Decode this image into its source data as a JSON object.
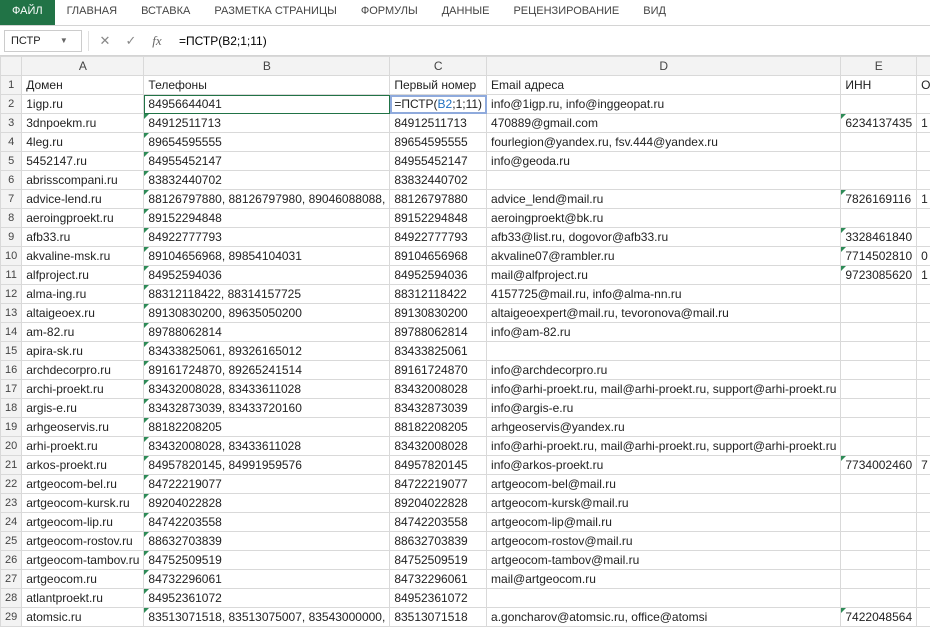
{
  "ribbon": {
    "file": "ФАЙЛ",
    "tabs": [
      "ГЛАВНАЯ",
      "ВСТАВКА",
      "РАЗМЕТКА СТРАНИЦЫ",
      "ФОРМУЛЫ",
      "ДАННЫЕ",
      "РЕЦЕНЗИРОВАНИЕ",
      "ВИД"
    ]
  },
  "formula_bar": {
    "namebox": "ПСТР",
    "formula": "=ПСТР(B2;1;11)"
  },
  "columns": [
    "A",
    "B",
    "C",
    "D",
    "E"
  ],
  "headers": {
    "A": "Домен",
    "B": "Телефоны",
    "C": "Первый номер",
    "D": "Email адреса",
    "E": "ИНН",
    "F": "О"
  },
  "active_cell_value": "84956644041",
  "edit_cell": {
    "prefix": "=ПСТР(",
    "ref": "B2",
    "suffix": ";1;11)"
  },
  "rows": [
    {
      "n": 2,
      "A": "1igp.ru",
      "B": "",
      "C": "",
      "D": "info@1igp.ru, info@inggeopat.ru",
      "E": ""
    },
    {
      "n": 3,
      "A": "3dnpoekm.ru",
      "B": "84912511713",
      "C": "84912511713",
      "D": "470889@gmail.com",
      "E": "6234137435",
      "Etri": true,
      "F": "1"
    },
    {
      "n": 4,
      "A": "4leg.ru",
      "B": "89654595555",
      "C": "89654595555",
      "D": "fourlegion@yandex.ru, fsv.444@yandex.ru",
      "E": ""
    },
    {
      "n": 5,
      "A": "5452147.ru",
      "B": "84955452147",
      "C": "84955452147",
      "D": "info@geoda.ru",
      "E": ""
    },
    {
      "n": 6,
      "A": "abrisscompani.ru",
      "B": "83832440702",
      "C": "83832440702",
      "D": "",
      "E": ""
    },
    {
      "n": 7,
      "A": "advice-lend.ru",
      "B": "88126797880, 88126797980, 89046088088,",
      "C": "88126797880",
      "D": "advice_lend@mail.ru",
      "E": "7826169116",
      "Etri": true,
      "F": "1"
    },
    {
      "n": 8,
      "A": "aeroingproekt.ru",
      "B": "89152294848",
      "C": "89152294848",
      "D": "aeroingproekt@bk.ru",
      "E": ""
    },
    {
      "n": 9,
      "A": "afb33.ru",
      "B": "84922777793",
      "C": "84922777793",
      "D": "afb33@list.ru, dogovor@afb33.ru",
      "E": "3328461840",
      "Etri": true
    },
    {
      "n": 10,
      "A": "akvaline-msk.ru",
      "B": "89104656968, 89854104031",
      "C": "89104656968",
      "D": "akvaline07@rambler.ru",
      "E": "7714502810",
      "Etri": true,
      "F": "0"
    },
    {
      "n": 11,
      "A": "alfproject.ru",
      "B": "84952594036",
      "C": "84952594036",
      "D": "mail@alfproject.ru",
      "E": "9723085620",
      "Etri": true,
      "F": "1"
    },
    {
      "n": 12,
      "A": "alma-ing.ru",
      "B": "88312118422, 88314157725",
      "C": "88312118422",
      "D": "4157725@mail.ru, info@alma-nn.ru",
      "E": ""
    },
    {
      "n": 13,
      "A": "altaigeoex.ru",
      "B": "89130830200, 89635050200",
      "C": "89130830200",
      "D": "altaigeoexpert@mail.ru, tevoronova@mail.ru",
      "E": ""
    },
    {
      "n": 14,
      "A": "am-82.ru",
      "B": "89788062814",
      "C": "89788062814",
      "D": "info@am-82.ru",
      "E": ""
    },
    {
      "n": 15,
      "A": "apira-sk.ru",
      "B": "83433825061, 89326165012",
      "C": "83433825061",
      "D": "",
      "E": ""
    },
    {
      "n": 16,
      "A": "archdecorpro.ru",
      "B": "89161724870, 89265241514",
      "C": "89161724870",
      "D": "info@archdecorpro.ru",
      "E": ""
    },
    {
      "n": 17,
      "A": "archi-proekt.ru",
      "B": "83432008028, 83433611028",
      "C": "83432008028",
      "D": "info@arhi-proekt.ru, mail@arhi-proekt.ru, support@arhi-proekt.ru",
      "E": ""
    },
    {
      "n": 18,
      "A": "argis-e.ru",
      "B": "83432873039, 83433720160",
      "C": "83432873039",
      "D": "info@argis-e.ru",
      "E": ""
    },
    {
      "n": 19,
      "A": "arhgeoservis.ru",
      "B": "88182208205",
      "C": "88182208205",
      "D": "arhgeoservis@yandex.ru",
      "E": ""
    },
    {
      "n": 20,
      "A": "arhi-proekt.ru",
      "B": "83432008028, 83433611028",
      "C": "83432008028",
      "D": "info@arhi-proekt.ru, mail@arhi-proekt.ru, support@arhi-proekt.ru",
      "E": ""
    },
    {
      "n": 21,
      "A": "arkos-proekt.ru",
      "B": "84957820145, 84991959576",
      "C": "84957820145",
      "D": "info@arkos-proekt.ru",
      "E": "7734002460",
      "Etri": true,
      "F": "7"
    },
    {
      "n": 22,
      "A": "artgeocom-bel.ru",
      "B": "84722219077",
      "C": "84722219077",
      "D": "artgeocom-bel@mail.ru",
      "E": ""
    },
    {
      "n": 23,
      "A": "artgeocom-kursk.ru",
      "B": "89204022828",
      "C": "89204022828",
      "D": "artgeocom-kursk@mail.ru",
      "E": ""
    },
    {
      "n": 24,
      "A": "artgeocom-lip.ru",
      "B": "84742203558",
      "C": "84742203558",
      "D": "artgeocom-lip@mail.ru",
      "E": ""
    },
    {
      "n": 25,
      "A": "artgeocom-rostov.ru",
      "B": "88632703839",
      "C": "88632703839",
      "D": "artgeocom-rostov@mail.ru",
      "E": ""
    },
    {
      "n": 26,
      "A": "artgeocom-tambov.ru",
      "B": "84752509519",
      "C": "84752509519",
      "D": "artgeocom-tambov@mail.ru",
      "E": ""
    },
    {
      "n": 27,
      "A": "artgeocom.ru",
      "B": "84732296061",
      "C": "84732296061",
      "D": "mail@artgeocom.ru",
      "E": ""
    },
    {
      "n": 28,
      "A": "atlantproekt.ru",
      "B": "84952361072",
      "C": "84952361072",
      "D": "",
      "E": ""
    },
    {
      "n": 29,
      "A": "atomsic.ru",
      "B": "83513071518, 83513075007, 83543000000,",
      "C": "83513071518",
      "D": "a.goncharov@atomsic.ru, office@atomsi",
      "E": "7422048564",
      "Etri": true
    }
  ]
}
